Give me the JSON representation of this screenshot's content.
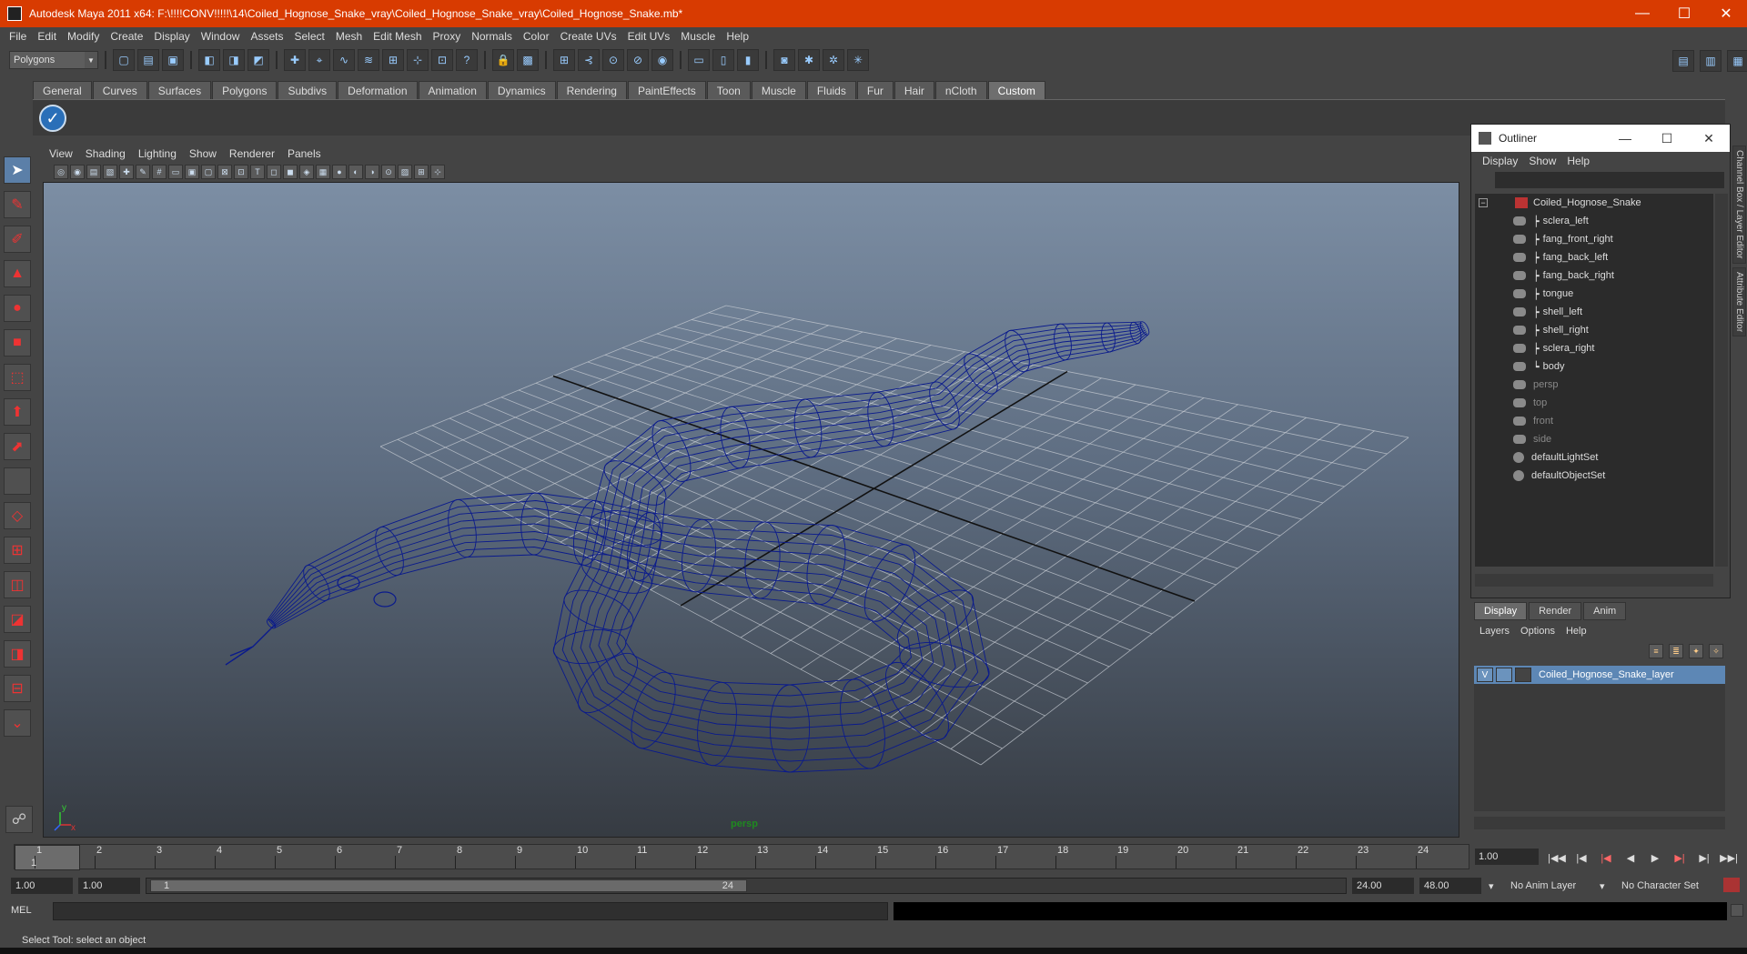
{
  "window": {
    "title": "Autodesk Maya 2011 x64: F:\\!!!!CONV!!!!!\\14\\Coiled_Hognose_Snake_vray\\Coiled_Hognose_Snake_vray\\Coiled_Hognose_Snake.mb*",
    "minimize": "—",
    "maximize": "☐",
    "close": "✕"
  },
  "menubar": [
    "File",
    "Edit",
    "Modify",
    "Create",
    "Display",
    "Window",
    "Assets",
    "Select",
    "Mesh",
    "Edit Mesh",
    "Proxy",
    "Normals",
    "Color",
    "Create UVs",
    "Edit UVs",
    "Muscle",
    "Help"
  ],
  "statusline": {
    "mode": "Polygons"
  },
  "shelf": {
    "tabs": [
      "General",
      "Curves",
      "Surfaces",
      "Polygons",
      "Subdivs",
      "Deformation",
      "Animation",
      "Dynamics",
      "Rendering",
      "PaintEffects",
      "Toon",
      "Muscle",
      "Fluids",
      "Fur",
      "Hair",
      "nCloth",
      "Custom"
    ],
    "active": "Custom"
  },
  "viewport": {
    "menus": [
      "View",
      "Shading",
      "Lighting",
      "Show",
      "Renderer",
      "Panels"
    ],
    "camera": "persp",
    "axis_x": "x",
    "axis_y": "y",
    "wire_color": "#0a1a8c"
  },
  "outliner": {
    "title": "Outliner",
    "menus": [
      "Display",
      "Show",
      "Help"
    ],
    "root": "Coiled_Hognose_Snake",
    "children": [
      "sclera_left",
      "fang_front_right",
      "fang_back_left",
      "fang_back_right",
      "tongue",
      "shell_left",
      "shell_right",
      "sclera_right",
      "body"
    ],
    "cameras": [
      "persp",
      "top",
      "front",
      "side"
    ],
    "sets": [
      "defaultLightSet",
      "defaultObjectSet"
    ]
  },
  "sidetabs": [
    "Channel Box / Layer Editor",
    "Attribute Editor"
  ],
  "layer_editor": {
    "tabs": [
      "Display",
      "Render",
      "Anim"
    ],
    "active": "Display",
    "menus": [
      "Layers",
      "Options",
      "Help"
    ],
    "layer": {
      "visible": "V",
      "name": "Coiled_Hognose_Snake_layer"
    }
  },
  "timeline": {
    "frames": [
      "1",
      "2",
      "3",
      "4",
      "5",
      "6",
      "7",
      "8",
      "9",
      "10",
      "11",
      "12",
      "13",
      "14",
      "15",
      "16",
      "17",
      "18",
      "19",
      "20",
      "21",
      "22",
      "23",
      "24"
    ],
    "current_frame": "1",
    "current_time": "1.00"
  },
  "range": {
    "start": "1.00",
    "playback_start": "1.00",
    "thumb_start": "1",
    "thumb_end": "24",
    "playback_end": "24.00",
    "end": "48.00",
    "anim_layer": "No Anim Layer",
    "char_set": "No Character Set"
  },
  "commandline": {
    "label": "MEL"
  },
  "helpline": "Select Tool: select an object"
}
